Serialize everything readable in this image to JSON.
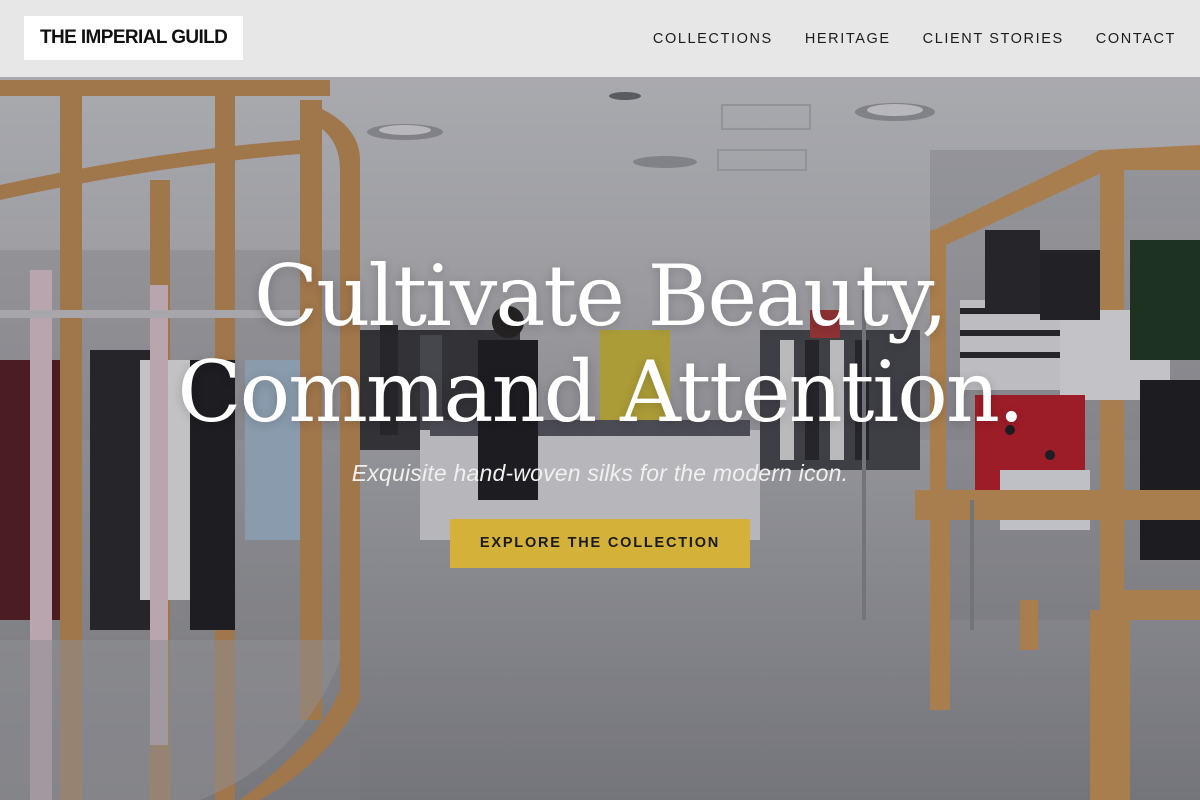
{
  "header": {
    "logo_text": "THE IMPERIAL GUILD",
    "nav": [
      {
        "label": "COLLECTIONS"
      },
      {
        "label": "HERITAGE"
      },
      {
        "label": "CLIENT STORIES"
      },
      {
        "label": "CONTACT"
      }
    ]
  },
  "hero": {
    "headline_line1": "Cultivate Beauty,",
    "headline_line2": "Command Attention.",
    "tagline": "Exquisite hand-woven silks for the modern icon.",
    "cta_label": "EXPLORE THE COLLECTION",
    "background_image": "retail-boutique-interior"
  },
  "colors": {
    "header_bg": "#ececec",
    "accent_gold": "#d4b23a",
    "headline_text": "#ffffff",
    "nav_text": "#1c1c1c"
  }
}
